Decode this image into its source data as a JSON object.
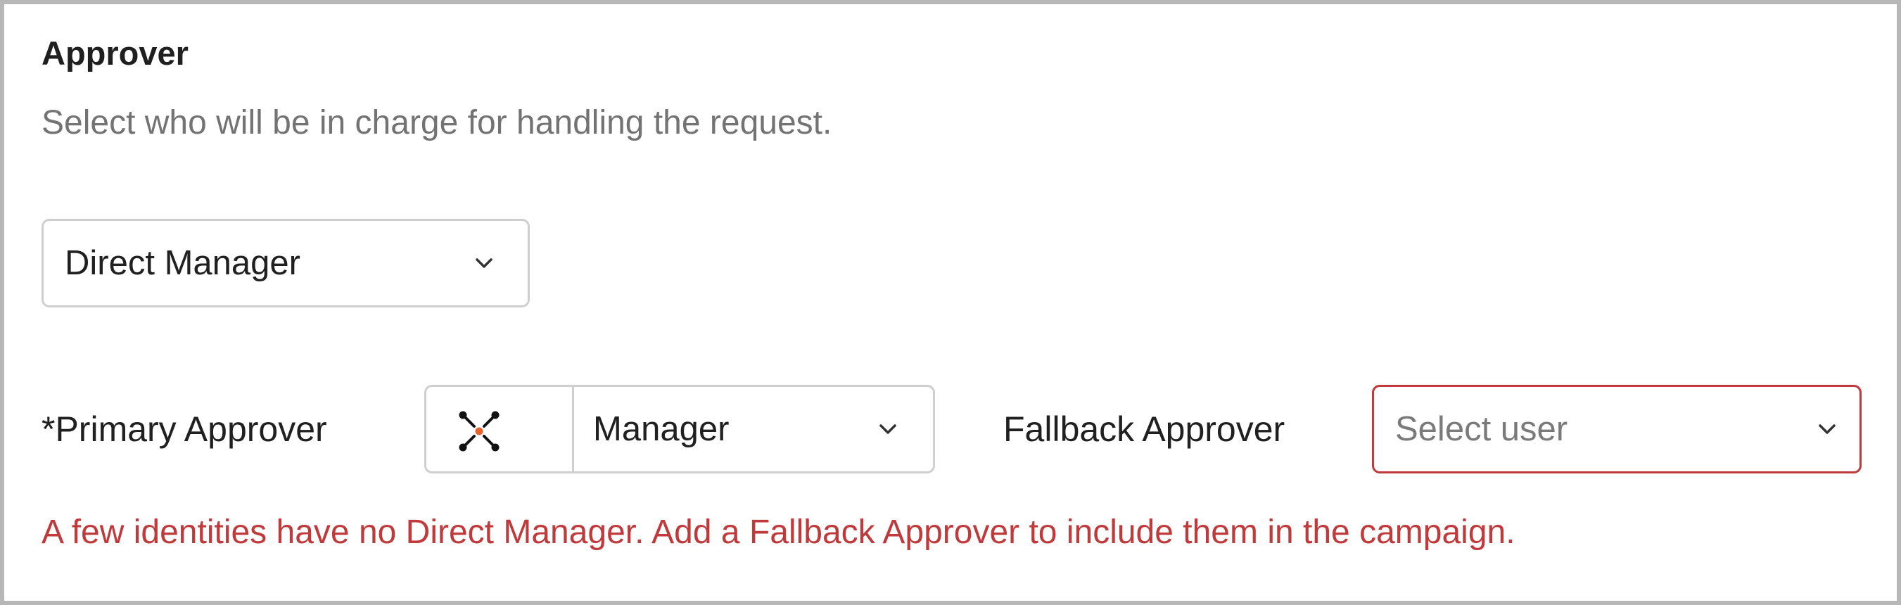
{
  "section": {
    "title": "Approver",
    "description": "Select who will be in charge for handling the request."
  },
  "approver_type": {
    "selected": "Direct Manager",
    "icon": "chevron-down-icon"
  },
  "primary": {
    "label": "*Primary Approver",
    "source_icon": "network-nodes-icon",
    "selected": "Manager"
  },
  "fallback": {
    "label": "Fallback Approver",
    "placeholder": "Select user"
  },
  "error_message": "A few identities have no Direct Manager. Add a Fallback Approver to include them in the campaign.",
  "colors": {
    "error": "#c0393b",
    "border": "#cfcfcf",
    "muted_text": "#737373",
    "icon_accent": "#e8632c"
  }
}
